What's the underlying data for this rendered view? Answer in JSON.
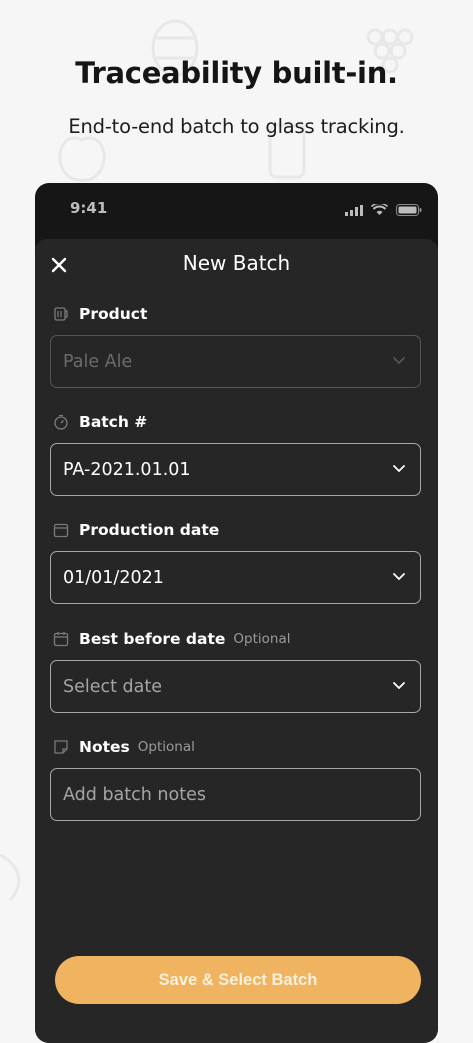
{
  "headline": "Traceability built-in.",
  "subline": "End-to-end batch to glass tracking.",
  "status_bar": {
    "time": "9:41"
  },
  "sheet": {
    "title": "New Batch",
    "close_icon": "close-icon",
    "fields": {
      "product": {
        "label": "Product",
        "value": "Pale Ale",
        "icon": "keg-icon",
        "disabled": true
      },
      "batch": {
        "label": "Batch #",
        "value": "PA-2021.01.01",
        "icon": "timer-icon"
      },
      "production_date": {
        "label": "Production date",
        "value": "01/01/2021",
        "icon": "calendar-icon"
      },
      "best_before": {
        "label": "Best before date",
        "optional": "Optional",
        "placeholder": "Select date",
        "icon": "calendar-icon"
      },
      "notes": {
        "label": "Notes",
        "optional": "Optional",
        "placeholder": "Add batch notes",
        "icon": "note-icon"
      }
    },
    "save_button": "Save & Select Batch"
  },
  "colors": {
    "background": "#f6f6f6",
    "phone": "#161616",
    "sheet": "#262626",
    "accent": "#f0b35f"
  }
}
